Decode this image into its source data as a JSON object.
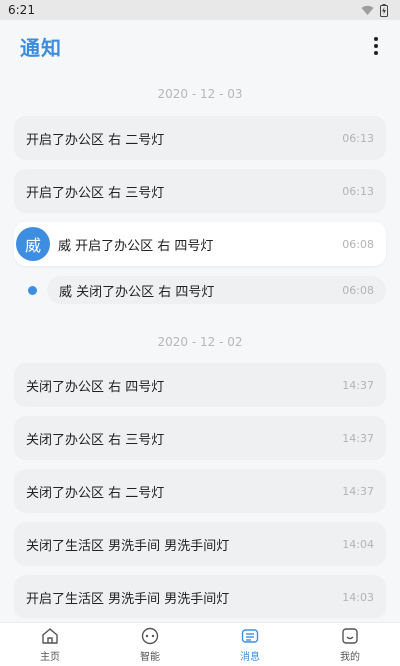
{
  "status": {
    "time": "6:21"
  },
  "header": {
    "title": "通知"
  },
  "sections": [
    {
      "date": "2020 - 12 - 03",
      "items": [
        {
          "text": "开启了办公区  右 二号灯",
          "time": "06:13"
        },
        {
          "text": "开启了办公区  右 三号灯",
          "time": "06:13"
        },
        {
          "avatar": "威",
          "text": "威  开启了办公区  右 四号灯",
          "time": "06:08"
        },
        {
          "text": "威  关闭了办公区  右 四号灯",
          "time": "06:08"
        }
      ]
    },
    {
      "date": "2020 - 12 - 02",
      "items": [
        {
          "text": "关闭了办公区  右 四号灯",
          "time": "14:37"
        },
        {
          "text": "关闭了办公区  右 三号灯",
          "time": "14:37"
        },
        {
          "text": "关闭了办公区  右 二号灯",
          "time": "14:37"
        },
        {
          "text": "关闭了生活区  男洗手间 男洗手间灯",
          "time": "14:04"
        },
        {
          "text": "开启了生活区  男洗手间 男洗手间灯",
          "time": "14:03"
        }
      ]
    }
  ],
  "tabs": [
    {
      "label": "主页",
      "icon": "home-icon"
    },
    {
      "label": "智能",
      "icon": "smart-icon"
    },
    {
      "label": "消息",
      "icon": "message-icon",
      "active": true
    },
    {
      "label": "我的",
      "icon": "profile-icon"
    }
  ],
  "colors": {
    "accent": "#3d8de0",
    "card": "#eff0f2",
    "background": "#f6f7f9"
  }
}
